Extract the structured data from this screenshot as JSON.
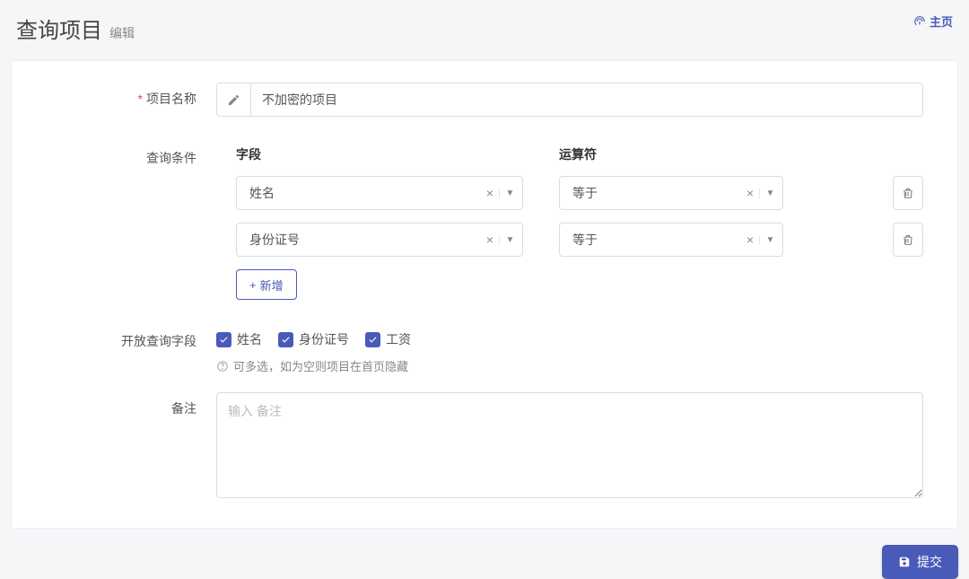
{
  "header": {
    "title": "查询项目",
    "subtitle": "编辑",
    "home": "主页"
  },
  "form": {
    "name_label": "项目名称",
    "name_value": "不加密的项目",
    "conditions_label": "查询条件",
    "cond_headers": {
      "field": "字段",
      "op": "运算符"
    },
    "conditions": [
      {
        "field": "姓名",
        "op": "等于"
      },
      {
        "field": "身份证号",
        "op": "等于"
      }
    ],
    "add_label": "新增",
    "open_fields_label": "开放查询字段",
    "open_fields": [
      {
        "label": "姓名",
        "checked": true
      },
      {
        "label": "身份证号",
        "checked": true
      },
      {
        "label": "工资",
        "checked": true
      }
    ],
    "open_fields_hint": "可多选，如为空则项目在首页隐藏",
    "remark_label": "备注",
    "remark_placeholder": "输入 备注",
    "remark_value": ""
  },
  "actions": {
    "submit": "提交"
  }
}
